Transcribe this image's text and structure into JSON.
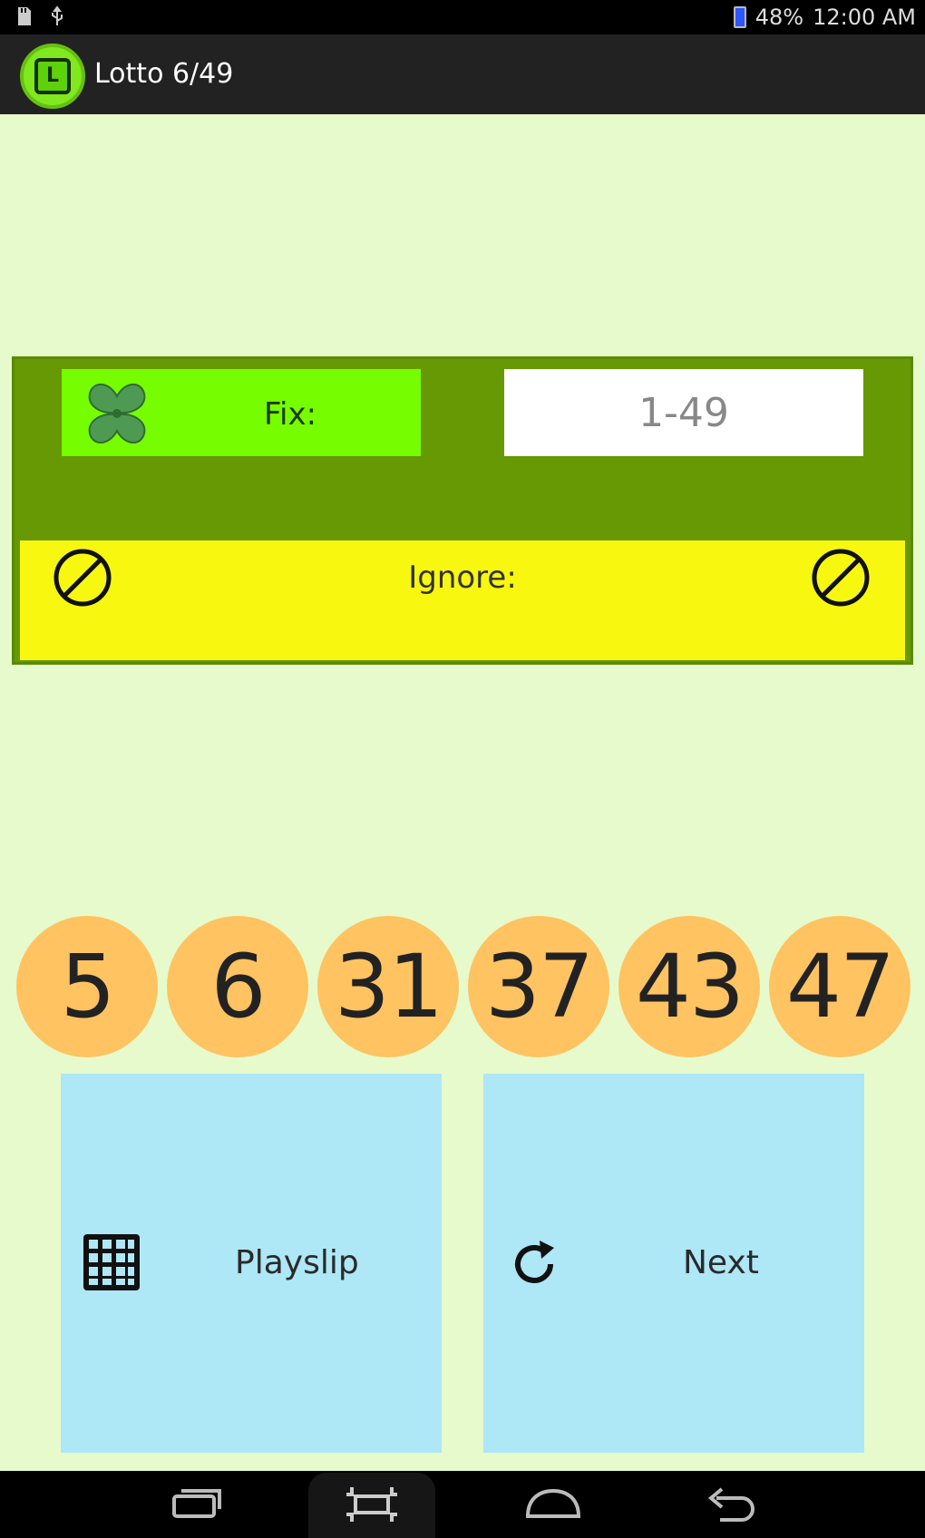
{
  "status_bar": {
    "left_icons": [
      "sd-card-icon",
      "usb-icon"
    ],
    "battery": "48%",
    "time": "12:00 AM"
  },
  "action_bar": {
    "logo_glyph": "L",
    "title": "Lotto 6/49"
  },
  "config": {
    "fix_label": "Fix:",
    "range_placeholder": "1-49",
    "ignore_label": "Ignore:"
  },
  "numbers": [
    "5",
    "6",
    "31",
    "37",
    "43",
    "47"
  ],
  "buttons": {
    "playslip_label": "Playslip",
    "next_label": "Next"
  },
  "colors": {
    "background": "#e6facb",
    "panel_green": "#669903",
    "fix_green": "#76fd00",
    "ignore_yellow": "#f8f710",
    "ball_orange": "#ffc361",
    "button_blue": "#aee7f6"
  }
}
